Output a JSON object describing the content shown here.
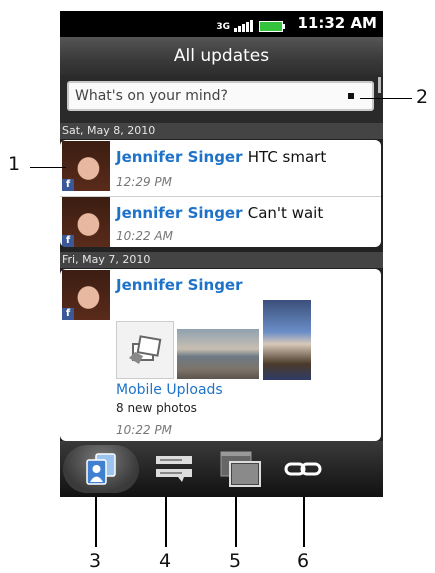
{
  "status_bar": {
    "network": "3G",
    "time": "11:32 AM"
  },
  "header": {
    "title": "All updates"
  },
  "composer": {
    "placeholder": "What's on your mind?"
  },
  "feed": {
    "groups": [
      {
        "date": "Sat, May 8, 2010",
        "items": [
          {
            "name": "Jennifer Singer",
            "status": "HTC smart",
            "time": "12:29 PM"
          },
          {
            "name": "Jennifer Singer",
            "status": "Can't wait",
            "time": "10:22 AM"
          }
        ]
      },
      {
        "date": "Fri, May 7, 2010",
        "items": [
          {
            "name": "Jennifer Singer",
            "album": "Mobile Uploads",
            "count": "8 new photos",
            "time": "10:22 PM"
          }
        ]
      }
    ]
  },
  "tabs": [
    {
      "icon": "all-updates-icon"
    },
    {
      "icon": "status-updates-icon"
    },
    {
      "icon": "photos-icon"
    },
    {
      "icon": "links-icon"
    }
  ],
  "callouts": [
    "1",
    "2",
    "3",
    "4",
    "5",
    "6"
  ],
  "colors": {
    "name_link": "#1e73c8",
    "facebook": "#3b5998",
    "battery": "#35c23d"
  }
}
